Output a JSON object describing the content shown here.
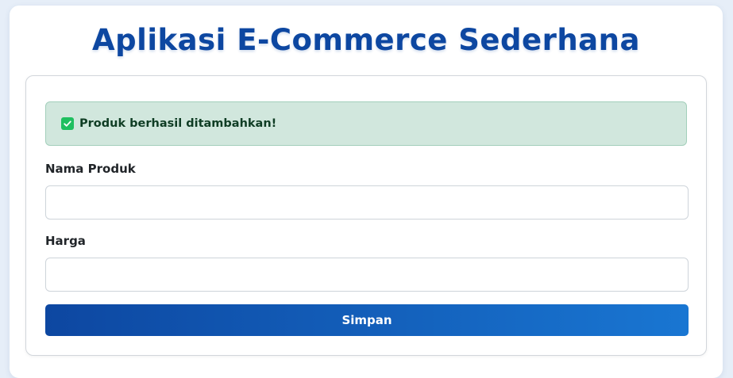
{
  "header": {
    "title": "Aplikasi E-Commerce Sederhana"
  },
  "alert": {
    "icon": "check-square-icon",
    "message": "Produk berhasil ditambahkan!",
    "status_color": "#1fbf5f"
  },
  "form": {
    "name_label": "Nama Produk",
    "name_value": "",
    "price_label": "Harga",
    "price_value": "",
    "submit_label": "Simpan"
  },
  "colors": {
    "brand": "#0d47a1",
    "accent": "#1976d2",
    "success_bg": "#d1e7dd"
  }
}
